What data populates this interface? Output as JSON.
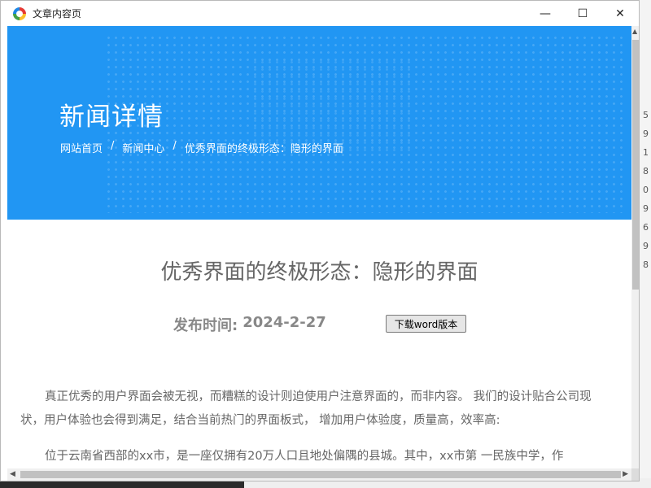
{
  "window": {
    "title": "文章内容页",
    "controls": {
      "minimize": "—",
      "maximize": "☐",
      "close": "✕"
    }
  },
  "hero": {
    "title": "新闻详情",
    "breadcrumb": {
      "home": "网站首页",
      "separator": "/",
      "section": "新闻中心",
      "current": "优秀界面的终极形态：隐形的界面"
    }
  },
  "article": {
    "title": "优秀界面的终极形态：隐形的界面",
    "publish_label": "发布时间:",
    "publish_date": "2024-2-27",
    "download_label": "下载word版本",
    "paragraphs": [
      "真正优秀的用户界面会被无视，而糟糕的设计则迫使用户注意界面的，而非内容。 我们的设计贴合公司现状，用户体验也会得到满足，结合当前热门的界面板式， 增加用户体验度，质量高，效率高:",
      "位于云南省西部的xx市，是一座仅拥有20万人口且地处偏隅的县城。其中，xx市第 一民族中学，作"
    ]
  },
  "background": {
    "digits": [
      "5",
      "9",
      "1",
      "8",
      "0",
      "9",
      "6",
      "9",
      "8"
    ]
  },
  "colors": {
    "hero_bg": "#2196f3",
    "text_gray": "#666666"
  }
}
